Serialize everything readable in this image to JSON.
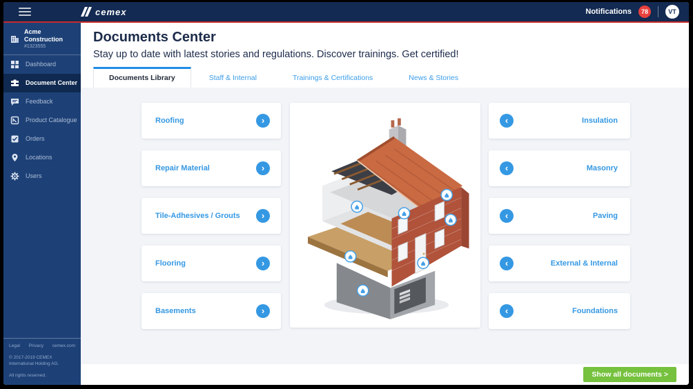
{
  "header": {
    "brand": "cemex",
    "notifications_label": "Notifications",
    "notifications_count": "78",
    "avatar_initials": "VT"
  },
  "sidebar": {
    "account": {
      "name": "Acme Construction",
      "number": "#1323555"
    },
    "items": [
      {
        "label": "Dashboard",
        "icon": "dashboard-grid",
        "active": false
      },
      {
        "label": "Document Center",
        "icon": "document-center",
        "active": true
      },
      {
        "label": "Feedback",
        "icon": "chat-bubble",
        "active": false
      },
      {
        "label": "Product Catalogue",
        "icon": "catalogue-tag",
        "active": false
      },
      {
        "label": "Orders",
        "icon": "checkbox",
        "active": false
      },
      {
        "label": "Locations",
        "icon": "map-pin",
        "active": false
      },
      {
        "label": "Users",
        "icon": "gear",
        "active": false
      }
    ],
    "footer": {
      "links": [
        "Legal",
        "Privacy",
        "cemex.com"
      ],
      "copyright_line1": "© 2017-2019 CEMEX",
      "copyright_line2": "International Holding AG.",
      "rights": "All rights reserved."
    }
  },
  "main": {
    "title": "Documents Center",
    "subtitle": "Stay up to date with latest stories and regulations. Discover trainings. Get certified!",
    "tabs": [
      {
        "label": "Documents Library",
        "active": true
      },
      {
        "label": "Staff & Internal",
        "active": false
      },
      {
        "label": "Trainings & Certifications",
        "active": false
      },
      {
        "label": "News & Stories",
        "active": false
      }
    ],
    "left_categories": [
      "Roofing",
      "Repair Material",
      "Tile-Adhesives / Grouts",
      "Flooring",
      "Basements"
    ],
    "right_categories": [
      "Insulation",
      "Masonry",
      "Paving",
      "External & Internal",
      "Foundations"
    ],
    "image_alt": "cutaway-house-illustration",
    "show_all_label": "Show all documents >"
  },
  "colors": {
    "topbar": "#132a52",
    "sidebar": "#1d4177",
    "sidebar_active": "#0f2950",
    "accent_red": "#c62a28",
    "accent_blue": "#3598e3",
    "tab_blue": "#1f8ce4",
    "badge_red": "#e8413d",
    "button_green": "#76c13e",
    "content_bg": "#f2f4f8"
  }
}
